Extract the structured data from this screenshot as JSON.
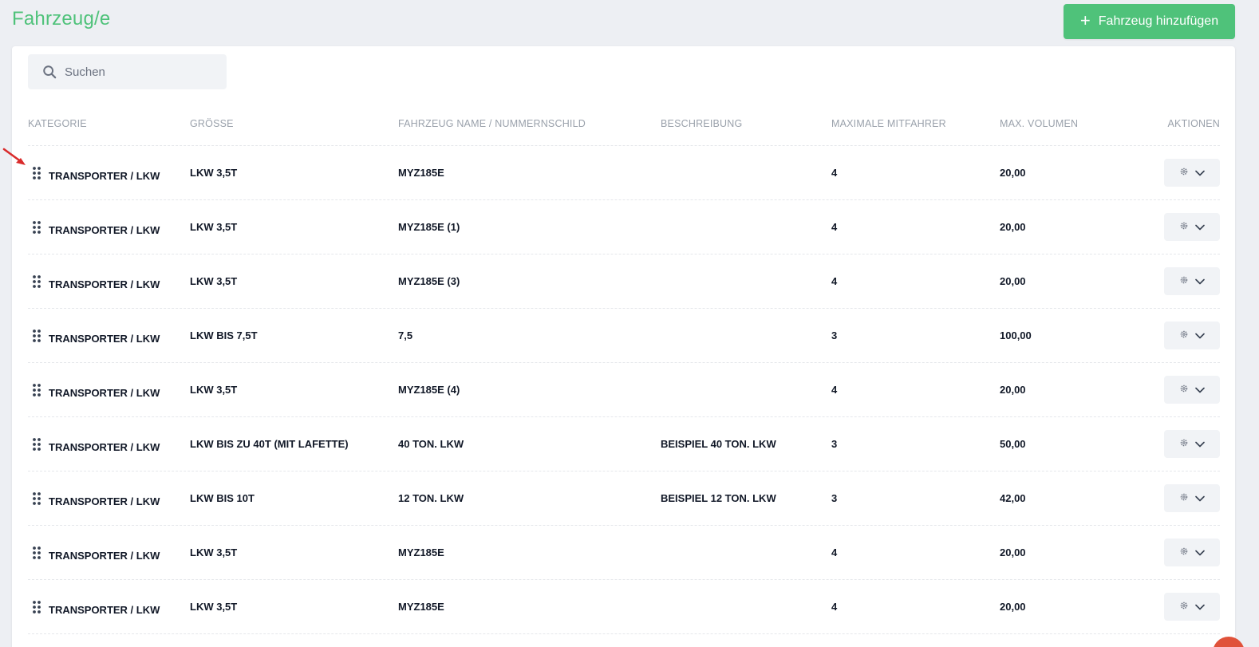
{
  "header": {
    "title": "Fahrzeug/e",
    "add_button_label": "Fahrzeug hinzufügen"
  },
  "search": {
    "placeholder": "Suchen"
  },
  "table": {
    "columns": [
      "KATEGORIE",
      "GRÖSSE",
      "FAHRZEUG NAME / NUMMERNSCHILD",
      "BESCHREIBUNG",
      "MAXIMALE MITFAHRER",
      "MAX. VOLUMEN",
      "AKTIONEN"
    ],
    "rows": [
      {
        "kategorie": "TRANSPORTER / LKW",
        "groesse": "LKW 3,5T",
        "name": "MYZ185E",
        "beschreibung": "",
        "mitfahrer": "4",
        "volumen": "20,00"
      },
      {
        "kategorie": "TRANSPORTER / LKW",
        "groesse": "LKW 3,5T",
        "name": "MYZ185E (1)",
        "beschreibung": "",
        "mitfahrer": "4",
        "volumen": "20,00"
      },
      {
        "kategorie": "TRANSPORTER / LKW",
        "groesse": "LKW 3,5T",
        "name": "MYZ185E (3)",
        "beschreibung": "",
        "mitfahrer": "4",
        "volumen": "20,00"
      },
      {
        "kategorie": "TRANSPORTER / LKW",
        "groesse": "LKW BIS 7,5T",
        "name": "7,5",
        "beschreibung": "",
        "mitfahrer": "3",
        "volumen": "100,00"
      },
      {
        "kategorie": "TRANSPORTER / LKW",
        "groesse": "LKW 3,5T",
        "name": "MYZ185E (4)",
        "beschreibung": "",
        "mitfahrer": "4",
        "volumen": "20,00"
      },
      {
        "kategorie": "TRANSPORTER / LKW",
        "groesse": "LKW BIS ZU 40T (MIT LAFETTE)",
        "name": "40 TON. LKW",
        "beschreibung": "BEISPIEL 40 TON. LKW",
        "mitfahrer": "3",
        "volumen": "50,00"
      },
      {
        "kategorie": "TRANSPORTER / LKW",
        "groesse": "LKW BIS 10T",
        "name": "12 TON. LKW",
        "beschreibung": "BEISPIEL 12 TON. LKW",
        "mitfahrer": "3",
        "volumen": "42,00"
      },
      {
        "kategorie": "TRANSPORTER / LKW",
        "groesse": "LKW 3,5T",
        "name": "MYZ185E",
        "beschreibung": "",
        "mitfahrer": "4",
        "volumen": "20,00"
      },
      {
        "kategorie": "TRANSPORTER / LKW",
        "groesse": "LKW 3,5T",
        "name": "MYZ185E",
        "beschreibung": "",
        "mitfahrer": "4",
        "volumen": "20,00"
      }
    ]
  },
  "icons": {
    "search": "search-icon",
    "drag": "drag-handle-icon",
    "gear": "gear-icon",
    "chevron": "chevron-down-icon",
    "annotation": "red-arrow-icon"
  },
  "colors": {
    "accent": "#4fc27a",
    "background": "#edeff3",
    "annotation": "#d92b2b"
  }
}
